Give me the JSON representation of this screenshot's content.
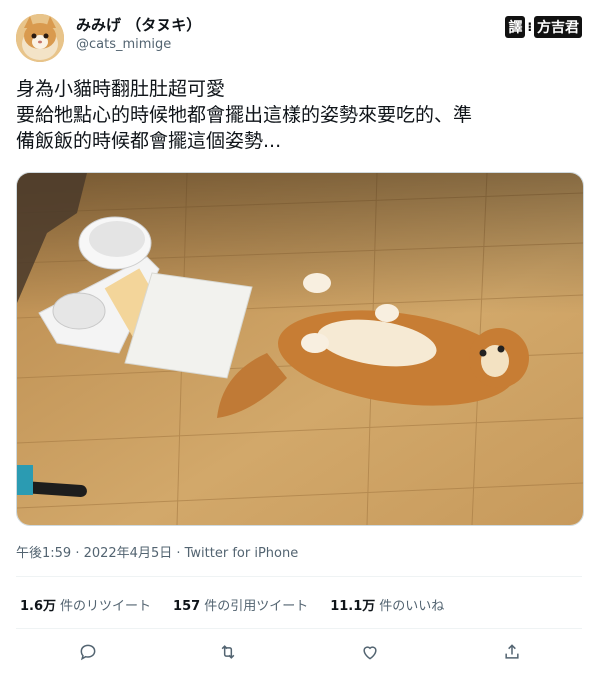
{
  "author": {
    "display_name": "みみげ （タヌキ）",
    "handle": "@cats_mimige"
  },
  "watermark": {
    "prefix": "譯",
    "sep": "⁝",
    "name": "方吉君"
  },
  "tweet": {
    "lines": [
      "身為小貓時翻肚肚超可愛",
      "要給牠點心的時候牠都會擺出這樣的姿勢來要吃的、準",
      "備飯飯的時候都會擺這個姿勢..."
    ],
    "timestamp": "午後1:59 · 2022年4月5日",
    "source": "Twitter for iPhone",
    "source_sep": " · "
  },
  "stats": {
    "retweets": {
      "count": "1.6万",
      "label": "件のリツイート"
    },
    "quotes": {
      "count": "157",
      "label": "件の引用ツイート"
    },
    "likes": {
      "count": "11.1万",
      "label": "件のいいね"
    }
  },
  "actions": [
    "reply-icon",
    "retweet-icon",
    "like-icon",
    "share-icon"
  ],
  "colors": {
    "text": "#0f1419",
    "secondary": "#536471",
    "divider": "#eff3f4"
  }
}
